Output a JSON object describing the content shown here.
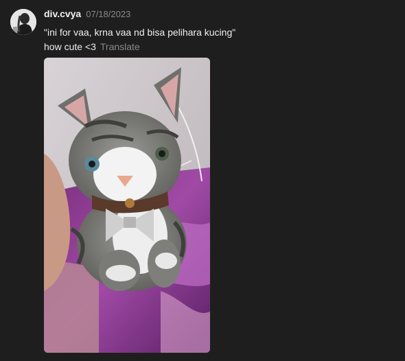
{
  "post": {
    "username": "div.cvya",
    "timestamp": "07/18/2023",
    "message_line1": "\"ini for vaa, krna vaa nd bisa pelihara kucing\"",
    "message_line2": "how cute <3",
    "translate_label": "Translate"
  },
  "icons": {
    "avatar": "avatar-photo",
    "attachment": "plush-cat-photo"
  },
  "colors": {
    "background": "#1e1e1e",
    "username": "#f2f2f2",
    "muted": "#8a8a8a",
    "text": "#efefef"
  }
}
